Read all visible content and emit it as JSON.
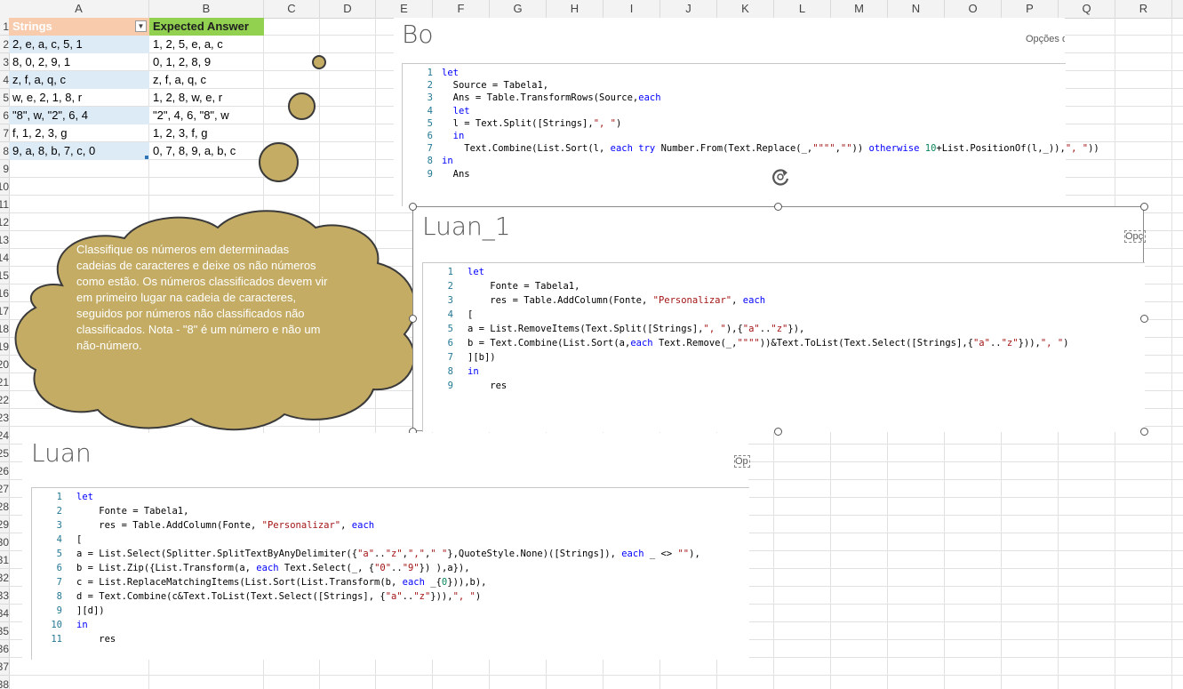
{
  "columns": [
    "A",
    "B",
    "C",
    "D",
    "E",
    "F",
    "G",
    "H",
    "I",
    "J",
    "K",
    "L",
    "M",
    "N",
    "O",
    "P",
    "Q",
    "R"
  ],
  "rows": [
    "1",
    "2",
    "3",
    "4",
    "5",
    "6",
    "7",
    "8",
    "9",
    "10",
    "11",
    "12",
    "13",
    "14",
    "15",
    "16",
    "17",
    "18",
    "19",
    "20",
    "21",
    "22",
    "23",
    "24",
    "25",
    "26",
    "27",
    "28",
    "29",
    "30",
    "31",
    "32",
    "33",
    "34",
    "35",
    "36",
    "37",
    "38"
  ],
  "table": {
    "header_a": "Strings",
    "header_b": "Expected Answer",
    "filter_icon": "▼",
    "rows": [
      {
        "a": "2, e, a, c, 5, 1",
        "b": "1, 2, 5, e, a, c"
      },
      {
        "a": "8, 0, 2, 9, 1",
        "b": "0, 1, 2, 8, 9"
      },
      {
        "a": "z, f, a, q, c",
        "b": "z, f, a, q, c"
      },
      {
        "a": "w, e, 2, 1, 8, r",
        "b": "1, 2, 8, w, e, r"
      },
      {
        "a": "\"8\", w, \"2\", 6, 4",
        "b": "\"2\", 4, 6, \"8\", w"
      },
      {
        "a": "f, 1, 2, 3, g",
        "b": "1, 2, 3, f, g"
      },
      {
        "a": "9, a, 8, b, 7, c, 0",
        "b": "0, 7, 8, 9, a, b, c"
      }
    ]
  },
  "cloud": {
    "text": "Classifique os números em determinadas cadeias de caracteres e deixe os não números como estão. Os números classificados devem vir em primeiro lugar na cadeia de caracteres, seguidos por números não classificados não classificados. Nota - \"8\" é um número e não um não-número.",
    "fill": "#c4ac64"
  },
  "panels": {
    "bo": {
      "title": "Bo",
      "options": "Opções d",
      "line_numbers": [
        "1",
        "2",
        "3",
        "4",
        "5",
        "6",
        "7",
        "8",
        "9"
      ]
    },
    "luan1": {
      "title": "Luan_1",
      "options": "Opç",
      "line_numbers": [
        "1",
        "2",
        "3",
        "4",
        "5",
        "6",
        "7",
        "8",
        "9"
      ]
    },
    "luan": {
      "title": "Luan",
      "options": "Op",
      "line_numbers": [
        "1",
        "2",
        "3",
        "4",
        "5",
        "6",
        "7",
        "8",
        "9",
        "10",
        "11"
      ]
    }
  },
  "code": {
    "bo": [
      "let",
      "  Source = Tabela1,",
      "  Ans = Table.TransformRows(Source,each",
      "  let",
      "  l = Text.Split([Strings],\", \")",
      "  in",
      "    Text.Combine(List.Sort(l, each try Number.From(Text.Replace(_,\"\"\"\",\"\")) otherwise 10+List.PositionOf(l,_)),\", \"))",
      "in",
      "  Ans"
    ],
    "luan1": [
      "let",
      "    Fonte = Tabela1,",
      "    res = Table.AddColumn(Fonte, \"Personalizar\", each",
      "[",
      "a = List.RemoveItems(Text.Split([Strings],\", \"),{\"a\"..\"z\"}),",
      "b = Text.Combine(List.Sort(a,each Text.Remove(_,\"\"\"\"))&Text.ToList(Text.Select([Strings],{\"a\"..\"z\"})),\", \")",
      "][b])",
      "in",
      "    res"
    ],
    "luan": [
      "let",
      "    Fonte = Tabela1,",
      "    res = Table.AddColumn(Fonte, \"Personalizar\", each",
      "[",
      "a = List.Select(Splitter.SplitTextByAnyDelimiter({\"a\"..\"z\",\",\",\" \"},QuoteStyle.None)([Strings]), each _ <> \"\"),",
      "b = List.Zip({List.Transform(a, each Text.Select(_, {\"0\"..\"9\"}) ),a}),",
      "c = List.ReplaceMatchingItems(List.Sort(List.Transform(b, each _{0})),b),",
      "d = Text.Combine(c&Text.ToList(Text.Select([Strings], {\"a\"..\"z\"})),\", \")",
      "][d])",
      "in",
      "    res"
    ]
  },
  "icons": {
    "rotate": "rotate-handle-icon"
  }
}
